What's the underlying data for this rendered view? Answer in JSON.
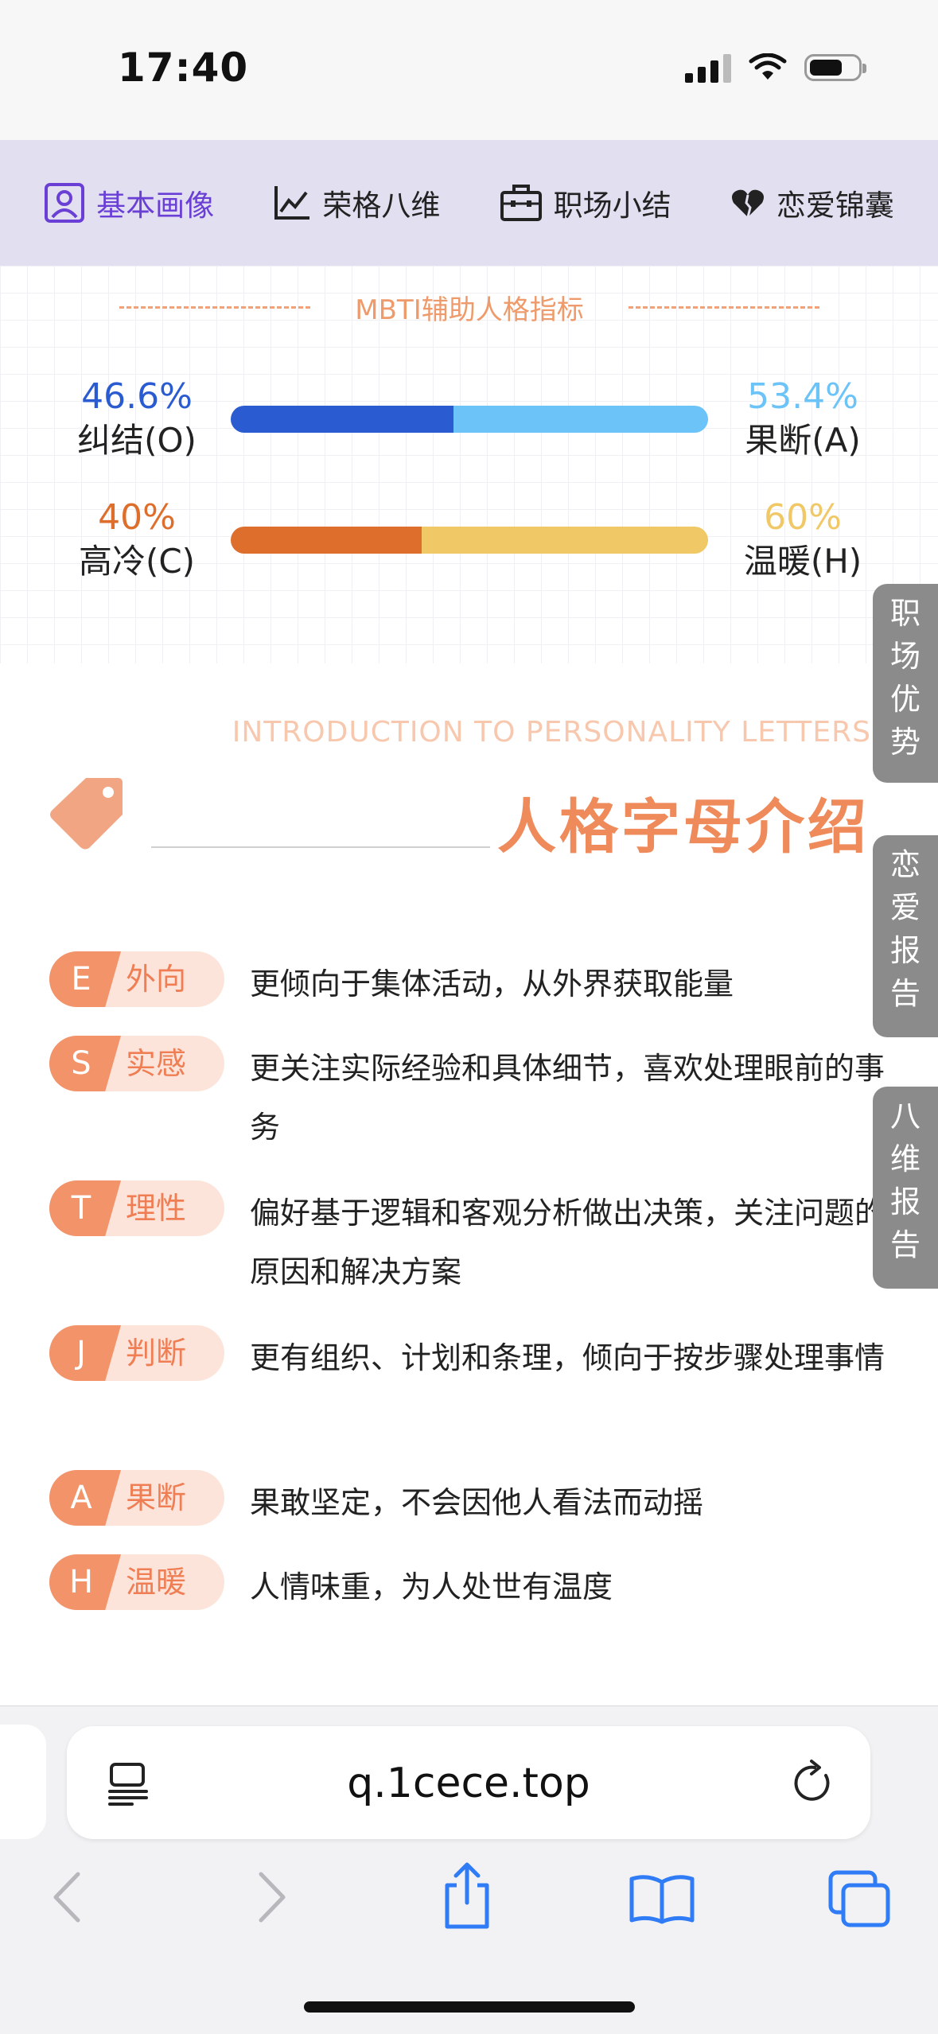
{
  "status": {
    "time": "17:40"
  },
  "tabs": [
    {
      "label": "基本画像",
      "icon": "person-icon",
      "active": true
    },
    {
      "label": "荣格八维",
      "icon": "line-chart-icon",
      "active": false
    },
    {
      "label": "职场小结",
      "icon": "briefcase-icon",
      "active": false
    },
    {
      "label": "恋爱锦囊",
      "icon": "heart-icon",
      "active": false
    }
  ],
  "mbti": {
    "title": "MBTI辅助人格指标",
    "metrics": [
      {
        "left_pct": "46.6%",
        "left_label": "纠结(O)",
        "right_pct": "53.4%",
        "right_label": "果断(A)",
        "left_value": 46.6,
        "left_color": "#2a5bd0",
        "right_color": "#6cc3f7"
      },
      {
        "left_pct": "40%",
        "left_label": "高冷(C)",
        "right_pct": "60%",
        "right_label": "温暖(H)",
        "left_value": 40,
        "left_color": "#dd6e2c",
        "right_color": "#f0c865"
      }
    ]
  },
  "section": {
    "subtitle_en": "INTRODUCTION TO PERSONALITY LETTERS",
    "title": "人格字母介绍"
  },
  "letters": [
    {
      "letter": "E",
      "word": "外向",
      "desc": "更倾向于集体活动，从外界获取能量"
    },
    {
      "letter": "S",
      "word": "实感",
      "desc": "更关注实际经验和具体细节，喜欢处理眼前的事务"
    },
    {
      "letter": "T",
      "word": "理性",
      "desc": "偏好基于逻辑和客观分析做出决策，关注问题的原因和解决方案"
    },
    {
      "letter": "J",
      "word": "判断",
      "desc": "更有组织、计划和条理，倾向于按步骤处理事情"
    },
    {
      "letter": "A",
      "word": "果断",
      "desc": "果敢坚定，不会因他人看法而动摇"
    },
    {
      "letter": "H",
      "word": "温暖",
      "desc": "人情味重，为人处世有温度"
    }
  ],
  "side_tabs": [
    {
      "label": "职场优势"
    },
    {
      "label": "恋爱报告"
    },
    {
      "label": "八维报告"
    }
  ],
  "browser": {
    "url": "q.1cece.top"
  }
}
